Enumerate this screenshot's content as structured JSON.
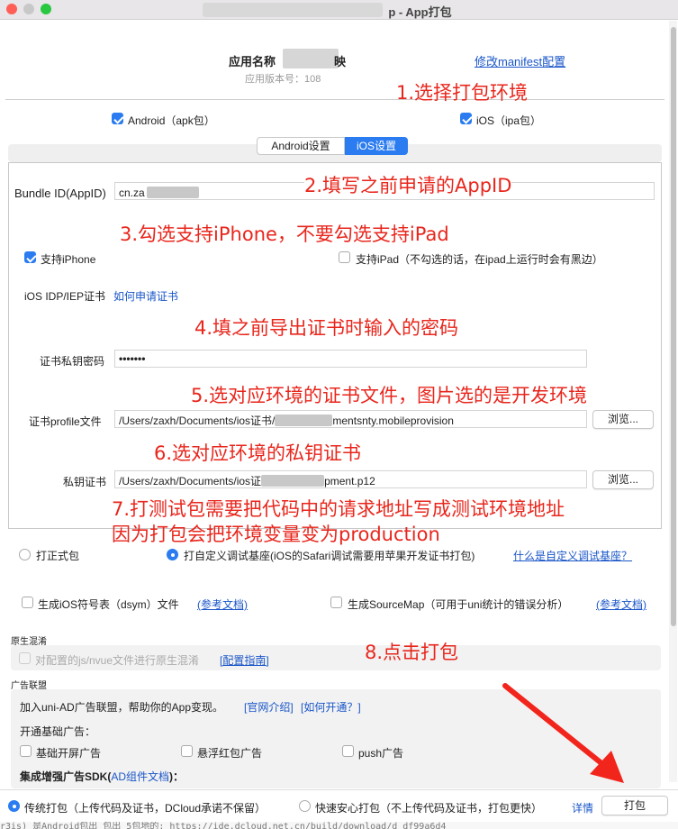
{
  "window": {
    "title": "p - App打包"
  },
  "header": {
    "app_name_label": "应用名称",
    "app_name_suffix": "映",
    "app_version_label": "应用版本号：108",
    "manifest_link": "修改manifest配置"
  },
  "platforms": {
    "android": {
      "label": "Android（apk包）",
      "checked": true
    },
    "ios": {
      "label": "iOS（ipa包）",
      "checked": true
    }
  },
  "tabs": [
    {
      "label": "Android设置",
      "active": false
    },
    {
      "label": "iOS设置",
      "active": true
    }
  ],
  "ios": {
    "bundle_id_label": "Bundle ID(AppID)",
    "bundle_id_value": "cn.za",
    "support_iphone_label": "支持iPhone",
    "support_iphone_checked": true,
    "support_ipad_label": "支持iPad（不勾选的话，在ipad上运行时会有黑边）",
    "support_ipad_checked": false,
    "cert_label": "iOS IDP/IEP证书",
    "cert_help_link": "如何申请证书",
    "cert_password_label": "证书私钥密码",
    "cert_password_value": "•••••••",
    "profile_label": "证书profile文件",
    "profile_value_prefix": "/Users/zaxh/Documents/ios证书/",
    "profile_value_suffix": "mentsnty.mobileprovision",
    "browse_label": "浏览...",
    "private_key_label": "私钥证书",
    "private_key_value_prefix": "/Users/zaxh/Documents/ios证",
    "private_key_value_suffix": "pment.p12"
  },
  "annotations": {
    "a1": "1.选择打包环境",
    "a2": "2.填写之前申请的AppID",
    "a3": "3.勾选支持iPhone，不要勾选支持iPad",
    "a4": "4.填之前导出证书时输入的密码",
    "a5": "5.选对应环境的证书文件，图片选的是开发环境",
    "a6": "6.选对应环境的私钥证书",
    "a7_line1": "7.打测试包需要把代码中的请求地址写成测试环境地址",
    "a7_line2": "因为打包会把环境变量变为production",
    "a8": "8.点击打包"
  },
  "build_type": {
    "formal_label": "打正式包",
    "formal_checked": false,
    "custom_label": "打自定义调试基座(iOS的Safari调试需要用苹果开发证书打包)",
    "custom_checked": true,
    "custom_help_link": "什么是自定义调试基座？"
  },
  "options": {
    "dsym_label": "生成iOS符号表（dsym）文件",
    "dsym_link": "(参考文档)",
    "sourcemap_label": "生成SourceMap（可用于uni统计的错误分析）",
    "sourcemap_link": "(参考文档)"
  },
  "obfuscation": {
    "section_title": "原生混淆",
    "checkbox_label": "对配置的js/nvue文件进行原生混淆",
    "guide_link": "[配置指南]"
  },
  "ads": {
    "section_title": "广告联盟",
    "join_text": "加入uni-AD广告联盟，帮助你的App变现。",
    "official_link": "[官网介绍]",
    "how_link": "[如何开通？]",
    "basic_title": "开通基础广告：",
    "splash_label": "基础开屏广告",
    "float_label": "悬浮红包广告",
    "push_label": "push广告",
    "enhanced_title": "集成增强广告SDK(",
    "enhanced_link": "AD组件文档",
    "enhanced_suffix": ")："
  },
  "footer": {
    "traditional_label": "传统打包（上传代码及证书，DCloud承诺不保留）",
    "traditional_checked": true,
    "safe_label": "快速安心打包（不上传代码及证书，打包更快）",
    "safe_checked": false,
    "details_link": "详情",
    "build_button": "打包"
  },
  "status_line": "r3is)    是Android包出    包出    5包地的: https://ide.dcloud.net.cn/build/download/d  df99a6d4"
}
